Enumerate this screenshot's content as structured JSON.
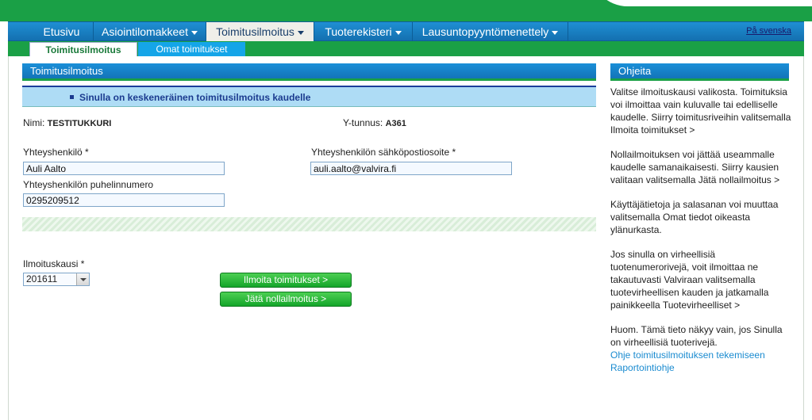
{
  "nav": {
    "items": [
      {
        "label": "Etusivu",
        "caret": false
      },
      {
        "label": "Asiointilomakkeet",
        "caret": true
      },
      {
        "label": "Toimitusilmoitus",
        "caret": true
      },
      {
        "label": "Tuoterekisteri",
        "caret": true
      },
      {
        "label": "Lausuntopyyntömenettely",
        "caret": true
      }
    ],
    "active_index": 2,
    "language_link": "På svenska"
  },
  "subnav": {
    "tabs": [
      "Toimitusilmoitus",
      "Omat toimitukset"
    ],
    "active_index": 0
  },
  "main": {
    "title": "Toimitusilmoitus",
    "notice": "Sinulla on keskeneräinen toimitusilmoitus kaudelle",
    "name_label": "Nimi:",
    "name_value": "TESTITUKKURI",
    "ytunnus_label": "Y-tunnus:",
    "ytunnus_value": "A361",
    "contact_label": "Yhteyshenkilö *",
    "contact_value": "Auli Aalto",
    "email_label": "Yhteyshenkilön sähköpostiosoite *",
    "email_value": "auli.aalto@valvira.fi",
    "phone_label": "Yhteyshenkilön puhelinnumero",
    "phone_value": "0295209512",
    "period_label": "Ilmoituskausi *",
    "period_value": "201611",
    "btn_report": "Ilmoita toimitukset >",
    "btn_zero": "Jätä nollailmoitus >"
  },
  "help": {
    "title": "Ohjeita",
    "paragraphs": [
      "Valitse ilmoituskausi valikosta. Toimituksia voi ilmoittaa vain kuluvalle tai edelliselle kaudelle. Siirry toimitusriveihin valitsemalla Ilmoita toimitukset >",
      "Nollailmoituksen voi jättää useammalle kaudelle samanaikaisesti. Siirry kausien valitaan valitsemalla Jätä nollailmoitus >",
      "Käyttäjätietoja ja salasanan voi muuttaa valitsemalla Omat tiedot oikeasta ylänurkasta.",
      "Jos sinulla on virheellisiä tuotenumerorivejä, voit ilmoittaa ne takautuvasti Valviraan valitsemalla tuotevirheellisen kauden ja jatkamalla painikkeella Tuotevirheelliset >",
      "Huom. Tämä tieto näkyy vain, jos Sinulla on virheellisiä tuoterivejä."
    ],
    "links": [
      "Ohje toimitusilmoituksen tekemiseen",
      "Raportointiohje"
    ]
  },
  "colors": {
    "brand_green": "#1aa046",
    "nav_blue": "#1f8fd4",
    "notice_bg": "#aedcf5",
    "link_blue": "#1a8bd0"
  }
}
